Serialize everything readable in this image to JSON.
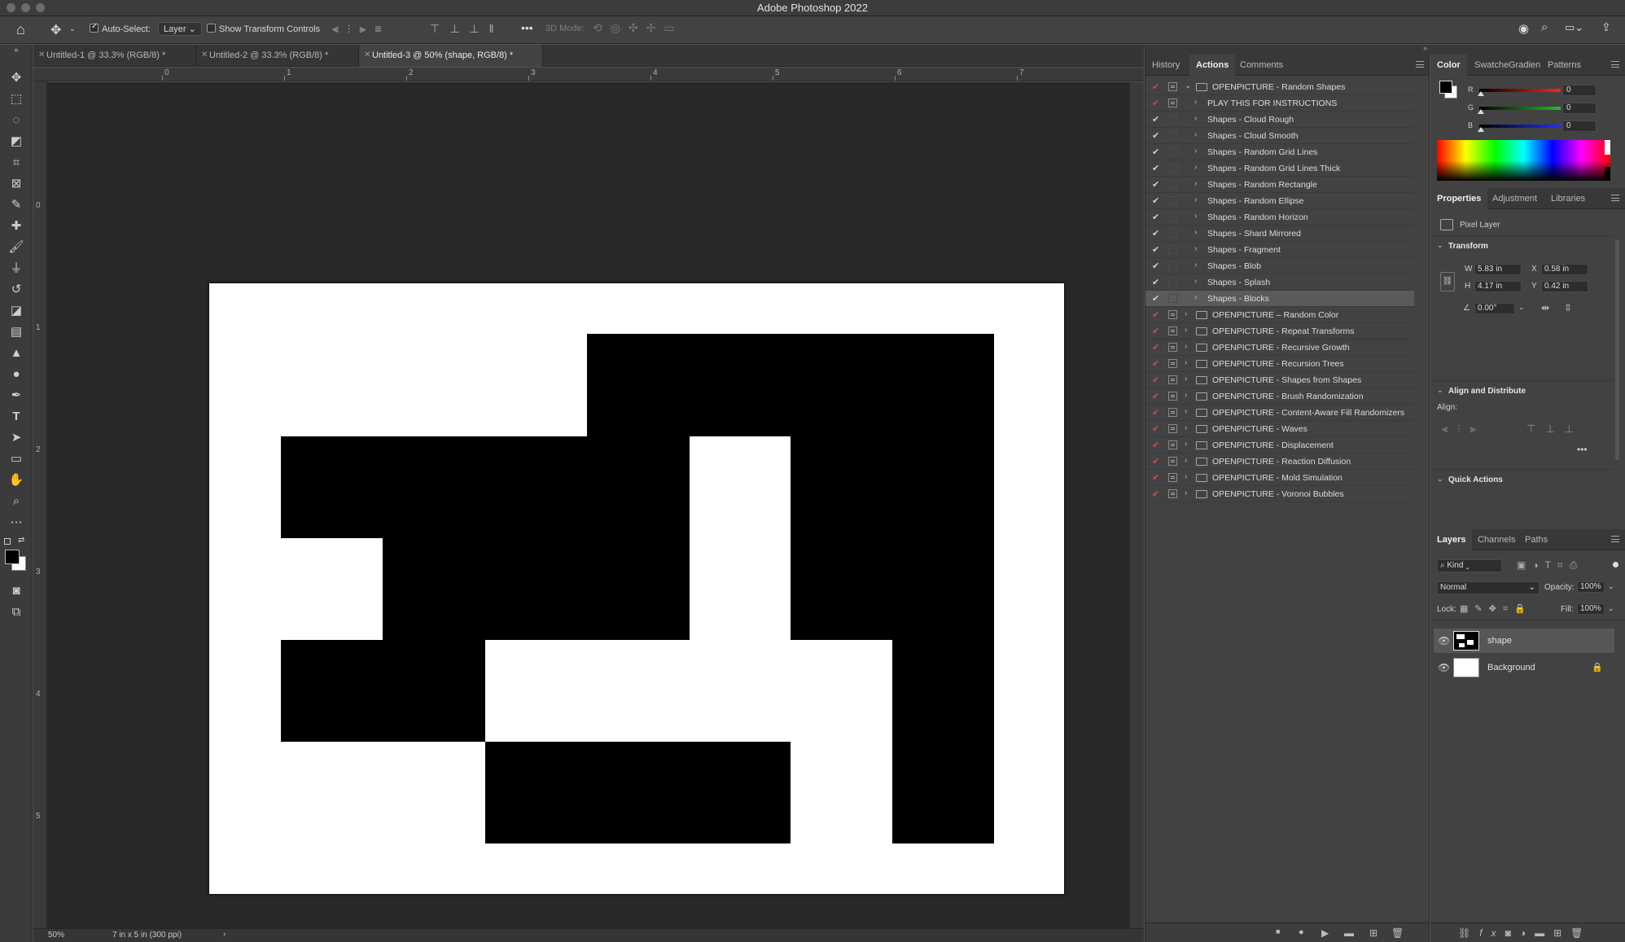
{
  "app": {
    "title": "Adobe Photoshop 2022"
  },
  "options_bar": {
    "auto_select_label": "Auto-Select:",
    "auto_select_value": "Layer",
    "show_transform_label": "Show Transform Controls",
    "mode_3d_label": "3D Mode:"
  },
  "doc_tabs": [
    {
      "label": "Untitled-1 @ 33.3% (RGB/8) *"
    },
    {
      "label": "Untitled-2 @ 33.3% (RGB/8) *"
    },
    {
      "label": "Untitled-3 @ 50% (shape, RGB/8) *"
    }
  ],
  "ruler": {
    "top": [
      "0",
      "1",
      "2",
      "3",
      "4",
      "5",
      "6",
      "7"
    ],
    "left": [
      "0",
      "1",
      "2",
      "3",
      "4",
      "5"
    ]
  },
  "status": {
    "zoom": "50%",
    "doc_size": "7 in x 5 in (300 ppi)"
  },
  "actions_panel": {
    "tabs": [
      "History",
      "Actions",
      "Comments"
    ],
    "active_tab": "Actions",
    "rows": [
      {
        "label": "OPENPICTURE - Random Shapes",
        "checked": true,
        "dialog": true,
        "set": true,
        "expanded": true,
        "selected": false
      },
      {
        "label": "PLAY THIS FOR INSTRUCTIONS",
        "checked": true,
        "dialog": true,
        "set": false,
        "selected": false
      },
      {
        "label": "Shapes - Cloud Rough",
        "checked": true,
        "dialog": false,
        "set": false,
        "selected": false
      },
      {
        "label": "Shapes - Cloud Smooth",
        "checked": true,
        "dialog": false,
        "set": false,
        "selected": false
      },
      {
        "label": "Shapes - Random Grid Lines",
        "checked": true,
        "dialog": false,
        "set": false,
        "selected": false
      },
      {
        "label": "Shapes - Random Grid Lines Thick",
        "checked": true,
        "dialog": false,
        "set": false,
        "selected": false
      },
      {
        "label": "Shapes - Random Rectangle",
        "checked": true,
        "dialog": false,
        "set": false,
        "selected": false
      },
      {
        "label": "Shapes - Random Ellipse",
        "checked": true,
        "dialog": false,
        "set": false,
        "selected": false
      },
      {
        "label": "Shapes - Random Horizon",
        "checked": true,
        "dialog": false,
        "set": false,
        "selected": false
      },
      {
        "label": "Shapes - Shard Mirrored",
        "checked": true,
        "dialog": false,
        "set": false,
        "selected": false
      },
      {
        "label": "Shapes - Fragment",
        "checked": true,
        "dialog": false,
        "set": false,
        "selected": false
      },
      {
        "label": "Shapes - Blob",
        "checked": true,
        "dialog": false,
        "set": false,
        "selected": false
      },
      {
        "label": "Shapes - Splash",
        "checked": true,
        "dialog": false,
        "set": false,
        "selected": false
      },
      {
        "label": "Shapes - Blocks",
        "checked": true,
        "dialog": false,
        "set": false,
        "selected": true
      },
      {
        "label": "OPENPICTURE – Random Color",
        "checked": true,
        "dialog": true,
        "set": true,
        "selected": false
      },
      {
        "label": "OPENPICTURE - Repeat Transforms",
        "checked": true,
        "dialog": true,
        "set": true,
        "selected": false
      },
      {
        "label": "OPENPICTURE - Recursive Growth",
        "checked": true,
        "dialog": true,
        "set": true,
        "selected": false
      },
      {
        "label": "OPENPICTURE - Recursion Trees",
        "checked": true,
        "dialog": true,
        "set": true,
        "selected": false
      },
      {
        "label": "OPENPICTURE - Shapes from Shapes",
        "checked": true,
        "dialog": true,
        "set": true,
        "selected": false
      },
      {
        "label": "OPENPICTURE - Brush Randomization",
        "checked": true,
        "dialog": true,
        "set": true,
        "selected": false
      },
      {
        "label": "OPENPICTURE - Content-Aware Fill Randomizers",
        "checked": true,
        "dialog": true,
        "set": true,
        "selected": false
      },
      {
        "label": "OPENPICTURE - Waves",
        "checked": true,
        "dialog": true,
        "set": true,
        "selected": false
      },
      {
        "label": "OPENPICTURE - Displacement",
        "checked": true,
        "dialog": true,
        "set": true,
        "selected": false
      },
      {
        "label": "OPENPICTURE - Reaction Diffusion",
        "checked": true,
        "dialog": true,
        "set": true,
        "selected": false
      },
      {
        "label": "OPENPICTURE - Mold Simulation",
        "checked": true,
        "dialog": true,
        "set": true,
        "selected": false
      },
      {
        "label": "OPENPICTURE - Voronoi Bubbles",
        "checked": true,
        "dialog": true,
        "set": true,
        "selected": false
      }
    ]
  },
  "color_panel": {
    "tabs": [
      "Color",
      "Swatche",
      "Gradien",
      "Patterns"
    ],
    "channels": [
      {
        "name": "R",
        "value": "0",
        "color": "#ff2020"
      },
      {
        "name": "G",
        "value": "0",
        "color": "#20c020"
      },
      {
        "name": "B",
        "value": "0",
        "color": "#2030ff"
      }
    ]
  },
  "properties_panel": {
    "tabs": [
      "Properties",
      "Adjustment",
      "Libraries"
    ],
    "layer_type": "Pixel Layer",
    "transform_title": "Transform",
    "w_label": "W",
    "w": "5.83 in",
    "h_label": "H",
    "h": "4.17 in",
    "x_label": "X",
    "x": "0.58 in",
    "y_label": "Y",
    "y": "0.42 in",
    "angle": "0.00°",
    "align_title": "Align and Distribute",
    "align_label": "Align:",
    "quick_actions_title": "Quick Actions"
  },
  "layers_panel": {
    "tabs": [
      "Layers",
      "Channels",
      "Paths"
    ],
    "filter": "Kind",
    "blend_mode": "Normal",
    "opacity_label": "Opacity:",
    "opacity": "100%",
    "lock_label": "Lock:",
    "fill_label": "Fill:",
    "fill": "100%",
    "layers": [
      {
        "name": "shape",
        "selected": true,
        "locked": false
      },
      {
        "name": "Background",
        "selected": false,
        "locked": true
      }
    ]
  }
}
